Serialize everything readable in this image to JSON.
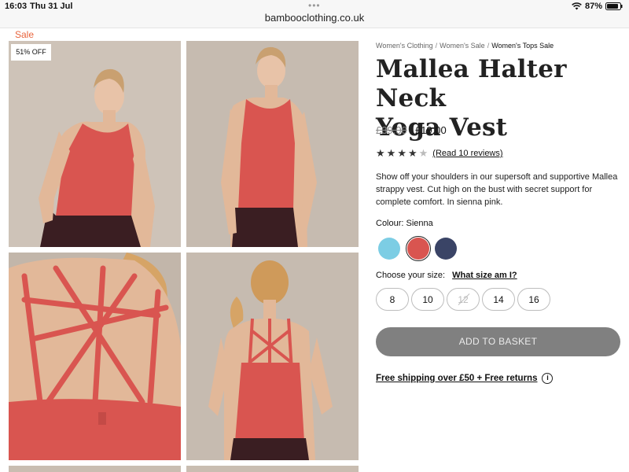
{
  "status_bar": {
    "time": "16:03",
    "date": "Thu 31 Jul",
    "url": "bambooclothing.co.uk",
    "battery": "87%",
    "more_dots": "•••"
  },
  "sale_label": "Sale",
  "discount_badge": "51% OFF",
  "breadcrumb": [
    "Women's Clothing",
    "Women's Sale",
    "Women's Tops Sale"
  ],
  "breadcrumb_sep": "/",
  "product": {
    "title_line1": "Mallea Halter Neck",
    "title_line2": "Yoga Vest",
    "old_price": "£39.00",
    "new_price": "£19.00",
    "rating_value": 4.5,
    "reviews_link": "(Read 10 reviews)",
    "description": "Show off your shoulders in our supersoft and supportive Mallea strappy vest. Cut high on the bust with secret support for complete comfort. In sienna pink.",
    "colour_label": "Colour:",
    "colour_value": "Sienna",
    "colours": [
      {
        "name": "sky-blue",
        "hex": "#7ccde4",
        "selected": false
      },
      {
        "name": "sienna",
        "hex": "#d95550",
        "selected": true
      },
      {
        "name": "navy",
        "hex": "#3a4466",
        "selected": false
      }
    ],
    "size_label": "Choose your size:",
    "size_guide": "What size am I?",
    "sizes": [
      {
        "label": "8",
        "available": true
      },
      {
        "label": "10",
        "available": true
      },
      {
        "label": "12",
        "available": false
      },
      {
        "label": "14",
        "available": true
      },
      {
        "label": "16",
        "available": true
      }
    ],
    "add_to_basket": "ADD TO BASKET",
    "shipping_text": "Free shipping over £50 + Free returns",
    "info_icon_glyph": "i"
  },
  "colors": {
    "sale": "#e8643c",
    "button": "#808080",
    "vest": "#d95550",
    "leggings": "#3a1e22",
    "background_photo": "#c9bdb1"
  }
}
